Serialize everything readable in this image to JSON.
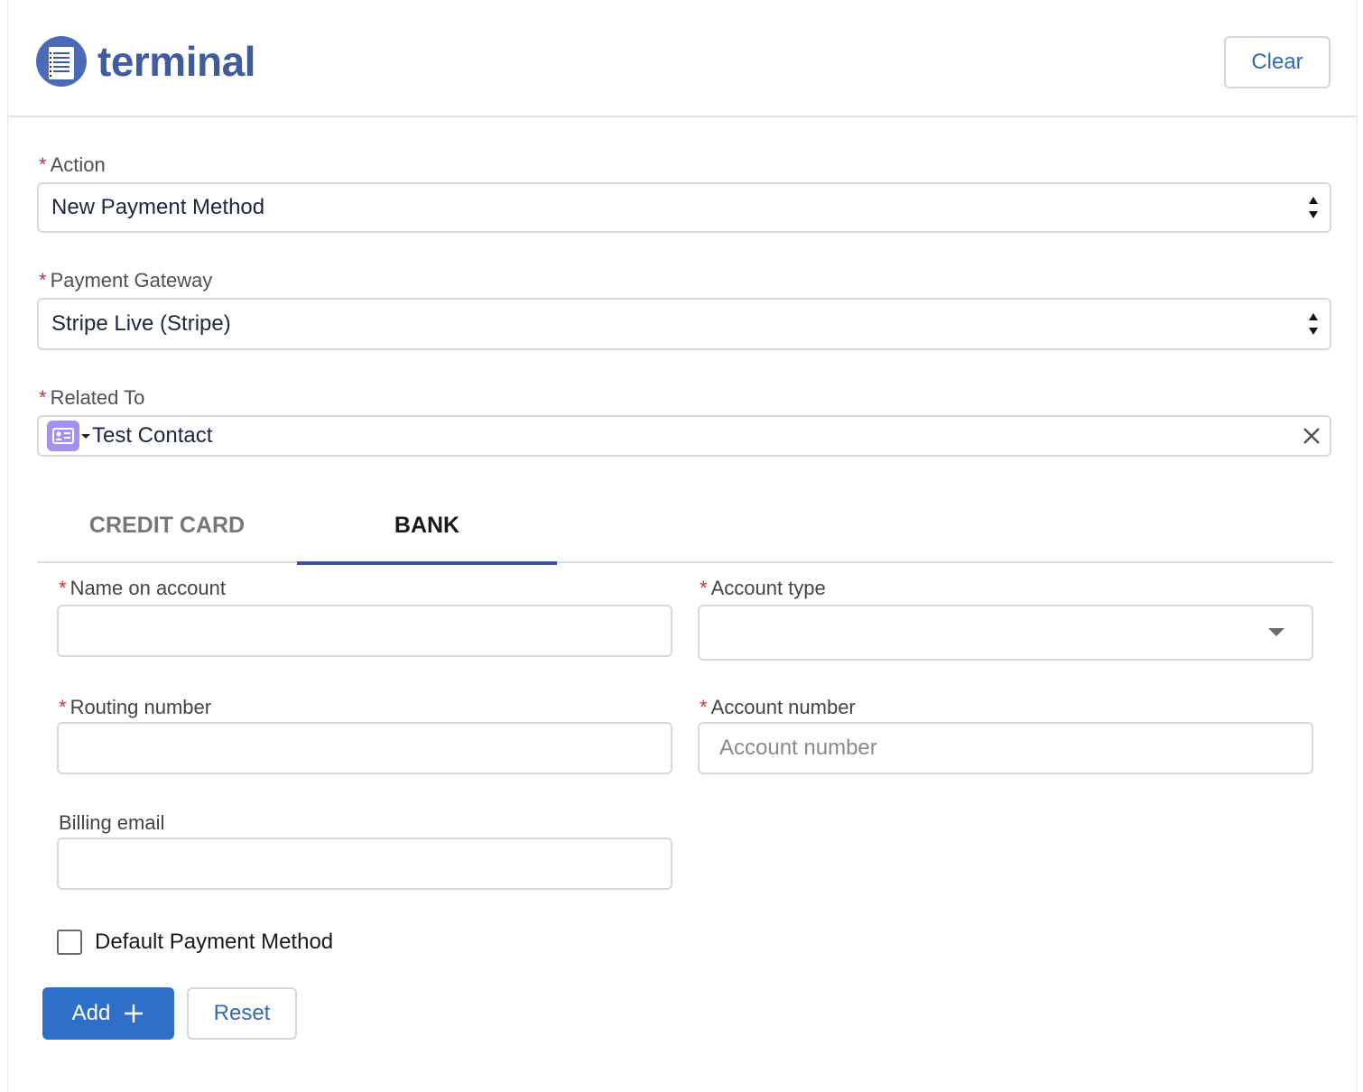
{
  "header": {
    "logo_text": "terminal",
    "clear_label": "Clear"
  },
  "form": {
    "action": {
      "label": "Action",
      "required_mark": "*",
      "value": "New Payment Method"
    },
    "gateway": {
      "label": "Payment Gateway",
      "required_mark": "*",
      "value": "Stripe Live (Stripe)"
    },
    "related": {
      "label": "Related To",
      "required_mark": "*",
      "value": "Test Contact",
      "icon": "contact-card-icon"
    }
  },
  "tabs": [
    {
      "label": "CREDIT CARD",
      "active": false
    },
    {
      "label": "BANK",
      "active": true
    }
  ],
  "bank": {
    "name_on_account": {
      "label": "Name on account",
      "required_mark": "*",
      "value": ""
    },
    "account_type": {
      "label": "Account type",
      "required_mark": "*",
      "value": ""
    },
    "routing_number": {
      "label": "Routing number",
      "required_mark": "*",
      "value": ""
    },
    "account_number": {
      "label": "Account number",
      "required_mark": "*",
      "placeholder": "Account number",
      "value": ""
    },
    "billing_email": {
      "label": "Billing email",
      "value": ""
    },
    "default_checkbox": {
      "label": "Default Payment Method",
      "checked": false
    }
  },
  "buttons": {
    "add_label": "Add",
    "add_icon": "plus",
    "reset_label": "Reset"
  },
  "colors": {
    "brand": "#3e5c9e",
    "primary": "#2e6fc9",
    "tab_indicator": "#3a4fae",
    "required": "#c23934"
  }
}
